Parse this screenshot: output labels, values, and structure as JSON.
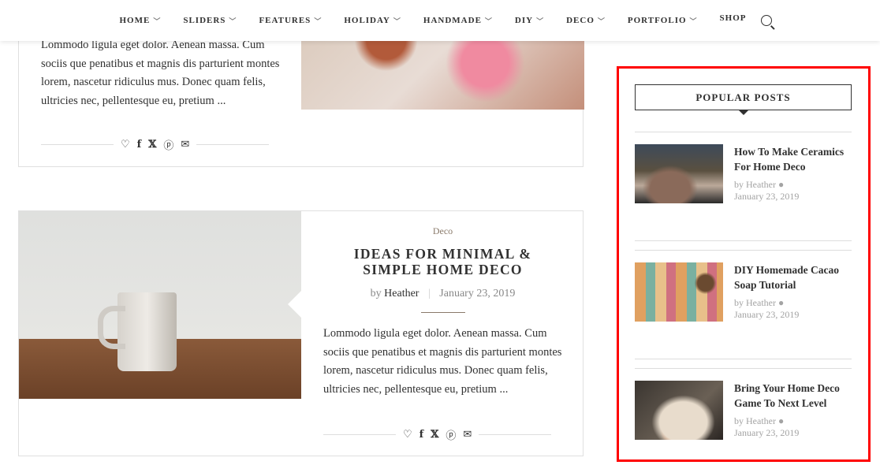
{
  "nav": {
    "items": [
      {
        "label": "HOME",
        "dropdown": true
      },
      {
        "label": "SLIDERS",
        "dropdown": true
      },
      {
        "label": "FEATURES",
        "dropdown": true
      },
      {
        "label": "HOLIDAY",
        "dropdown": true
      },
      {
        "label": "HANDMADE",
        "dropdown": true
      },
      {
        "label": "DIY",
        "dropdown": true
      },
      {
        "label": "DECO",
        "dropdown": true
      },
      {
        "label": "PORTFOLIO",
        "dropdown": true
      }
    ],
    "shop": "SHOP",
    "search_icon": "search-icon"
  },
  "posts": [
    {
      "excerpt": "Lommodo ligula eget dolor. Aenean massa. Cum sociis que penatibus et magnis dis parturient montes lorem, nascetur ridiculus mus. Donec quam felis, ultricies nec, pellentesque eu, pretium ..."
    },
    {
      "category": "Deco",
      "title": "IDEAS FOR MINIMAL & SIMPLE HOME DECO",
      "by": "by",
      "author": "Heather",
      "date": "January 23, 2019",
      "excerpt": "Lommodo ligula eget dolor. Aenean massa. Cum sociis que penatibus et magnis dis parturient montes lorem, nascetur ridiculus mus. Donec quam felis, ultricies nec, pellentesque eu, pretium ..."
    }
  ],
  "share_icons": [
    "heart-icon",
    "facebook-icon",
    "x-icon",
    "pinterest-icon",
    "email-icon"
  ],
  "sidebar": {
    "title": "POPULAR POSTS",
    "highlight_color": "#ff0000",
    "posts": [
      {
        "title": "How To Make Ceramics For Home Deco",
        "by": "by Heather",
        "date": "January 23, 2019"
      },
      {
        "title": "DIY Homemade Cacao Soap Tutorial",
        "by": "by Heather",
        "date": "January 23, 2019"
      },
      {
        "title": "Bring Your Home Deco Game To Next Level",
        "by": "by Heather",
        "date": "January 23, 2019"
      }
    ]
  }
}
